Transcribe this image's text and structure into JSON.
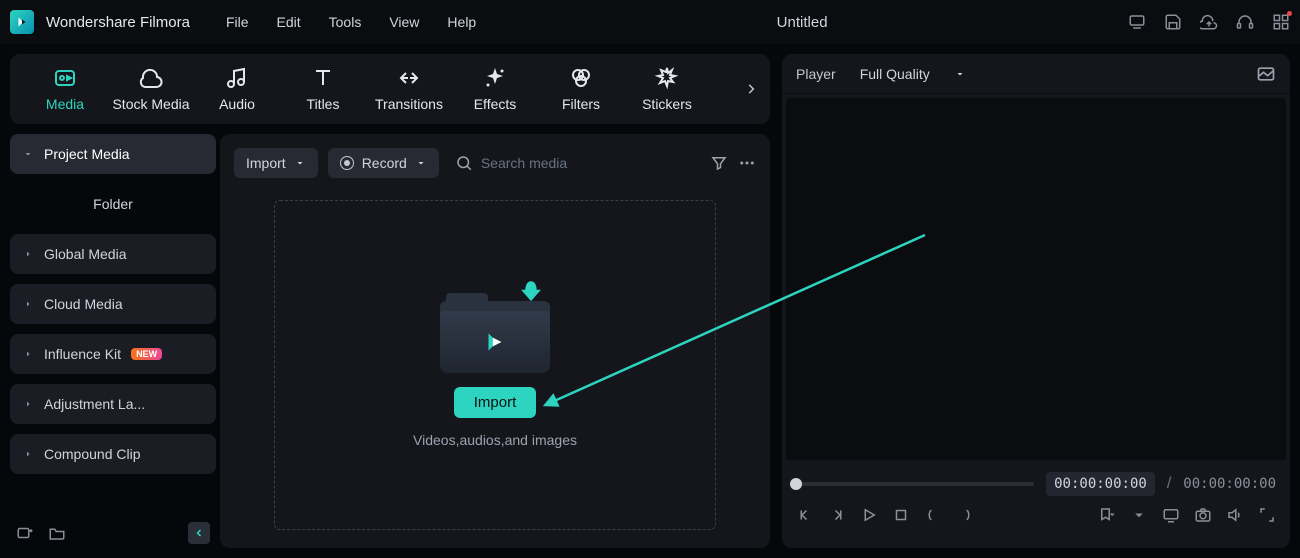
{
  "app": {
    "name": "Wondershare Filmora",
    "document": "Untitled"
  },
  "menu": [
    "File",
    "Edit",
    "Tools",
    "View",
    "Help"
  ],
  "tabs": [
    "Media",
    "Stock Media",
    "Audio",
    "Titles",
    "Transitions",
    "Effects",
    "Filters",
    "Stickers"
  ],
  "sidebar": {
    "project_media": "Project Media",
    "folder": "Folder",
    "items": [
      "Global Media",
      "Cloud Media",
      "Influence Kit",
      "Adjustment La...",
      "Compound Clip"
    ]
  },
  "toolbar": {
    "import": "Import",
    "record": "Record",
    "search_placeholder": "Search media"
  },
  "dropzone": {
    "button": "Import",
    "caption": "Videos,audios,and images"
  },
  "player": {
    "label": "Player",
    "quality": "Full Quality",
    "time_current": "00:00:00:00",
    "time_total": "00:00:00:00"
  },
  "badges": {
    "new": "NEW"
  }
}
